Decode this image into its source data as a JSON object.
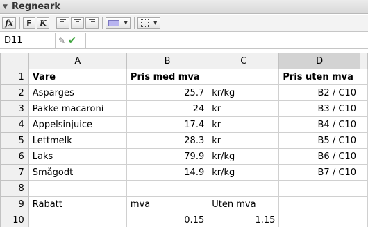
{
  "window": {
    "title": "Regneark"
  },
  "toolbar": {
    "fx_label": "fx",
    "bold_label": "F",
    "italic_label": "K"
  },
  "formula_bar": {
    "cell_ref": "D11",
    "value": ""
  },
  "columns": [
    "A",
    "B",
    "C",
    "D"
  ],
  "selected_column": "D",
  "rows": [
    {
      "n": "1",
      "A": "Vare",
      "B": "Pris med mva",
      "C": "",
      "D": "Pris uten mva"
    },
    {
      "n": "2",
      "A": "Asparges",
      "B": "25.7",
      "C": "kr/kg",
      "D": "B2 / C10"
    },
    {
      "n": "3",
      "A": "Pakke macaroni",
      "B": "24",
      "C": "kr",
      "D": "B3 / C10"
    },
    {
      "n": "4",
      "A": "Appelsinjuice",
      "B": "17.4",
      "C": "kr",
      "D": "B4 / C10"
    },
    {
      "n": "5",
      "A": "Lettmelk",
      "B": "28.3",
      "C": "kr",
      "D": "B5 / C10"
    },
    {
      "n": "6",
      "A": "Laks",
      "B": "79.9",
      "C": "kr/kg",
      "D": "B6 / C10"
    },
    {
      "n": "7",
      "A": "Smågodt",
      "B": "14.9",
      "C": "kr/kg",
      "D": "B7 / C10"
    },
    {
      "n": "8",
      "A": "",
      "B": "",
      "C": "",
      "D": ""
    },
    {
      "n": "9",
      "A": "Rabatt",
      "B": "mva",
      "C": "Uten mva",
      "D": ""
    },
    {
      "n": "10",
      "A": "",
      "B": "0.15",
      "C": "1.15",
      "D": ""
    }
  ],
  "colors": {
    "header_bg": "#f0f0f0",
    "selected_header_bg": "#d3d3d3",
    "grid_line": "#d0d0d0",
    "check": "#3aa33a"
  }
}
